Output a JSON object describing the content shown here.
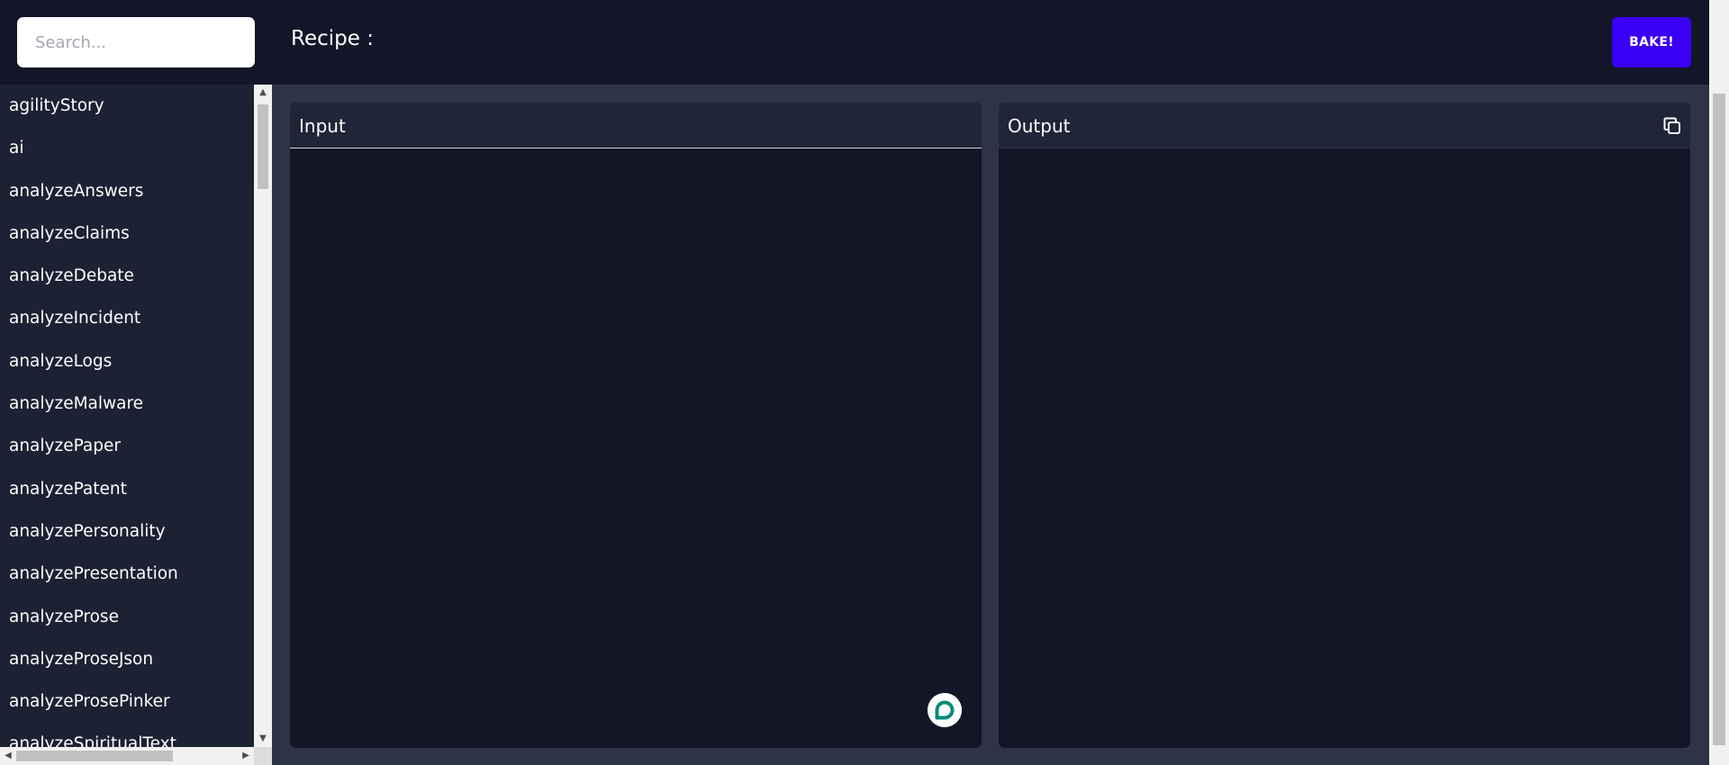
{
  "search": {
    "placeholder": "Search..."
  },
  "sidebar": {
    "items": [
      "agilityStory",
      "ai",
      "analyzeAnswers",
      "analyzeClaims",
      "analyzeDebate",
      "analyzeIncident",
      "analyzeLogs",
      "analyzeMalware",
      "analyzePaper",
      "analyzePatent",
      "analyzePersonality",
      "analyzePresentation",
      "analyzeProse",
      "analyzeProseJson",
      "analyzeProsePinker",
      "analyzeSpiritualText"
    ]
  },
  "header": {
    "recipe_label": "Recipe :",
    "bake_label": "BAKE!"
  },
  "panels": {
    "input_title": "Input",
    "output_title": "Output"
  },
  "icons": {
    "copy": "copy-icon",
    "chat": "chat-bubble-icon"
  },
  "colors": {
    "accent": "#3a00f5",
    "chat_icon": "#0a8a7a"
  }
}
